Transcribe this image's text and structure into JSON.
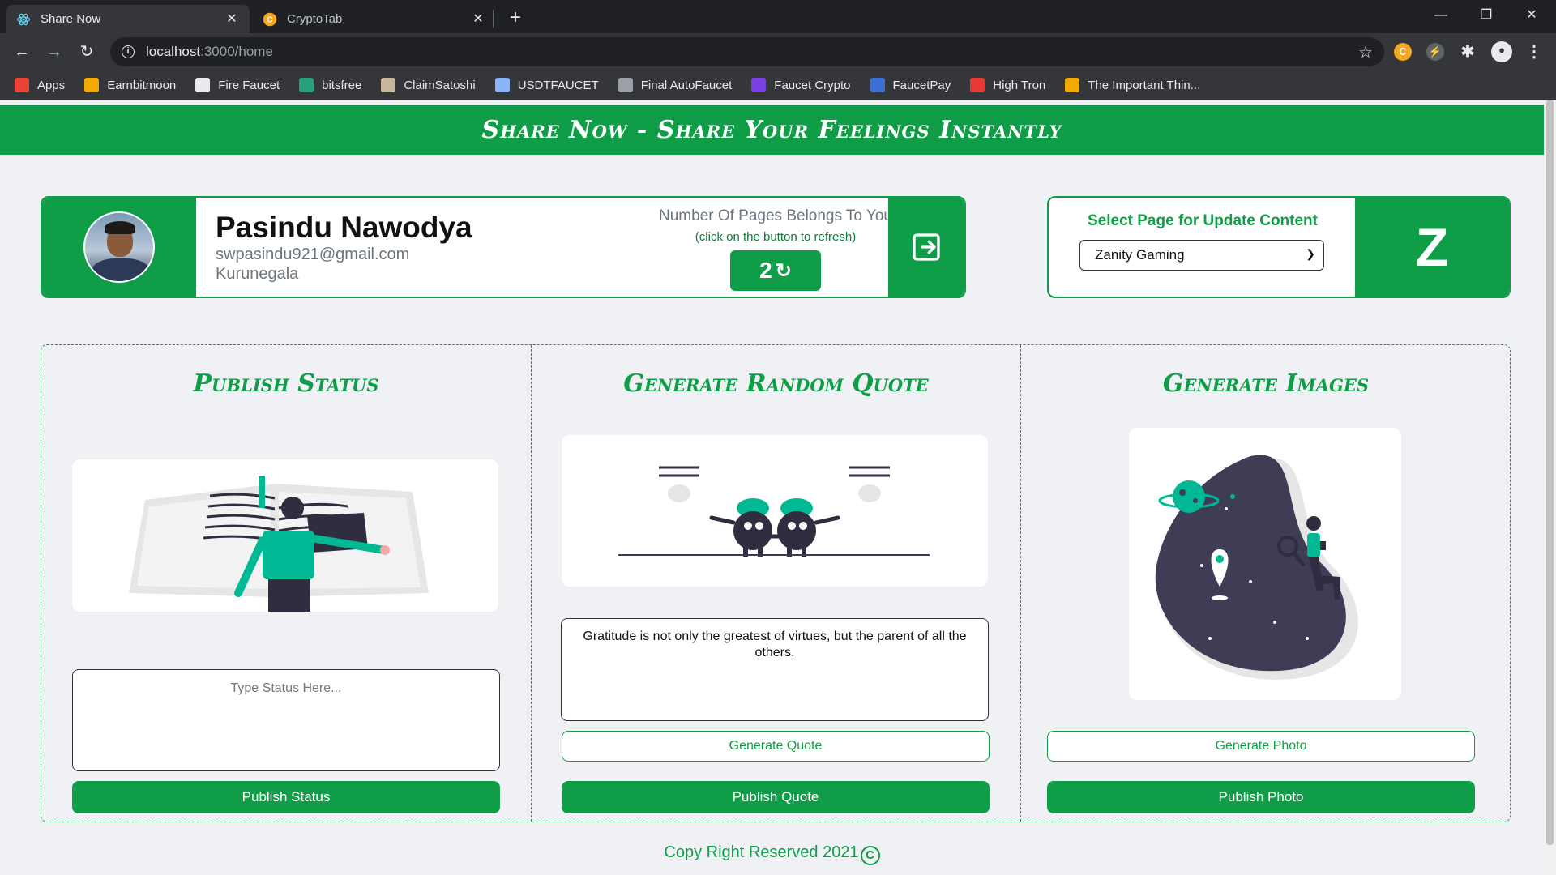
{
  "browser": {
    "tabs": [
      {
        "title": "Share Now",
        "active": true,
        "icon": "react-icon"
      },
      {
        "title": "CryptoTab",
        "active": false,
        "icon": "cryptotab-icon"
      }
    ],
    "url_host": "localhost",
    "url_path": ":3000/home",
    "bookmarks": [
      {
        "label": "Apps",
        "icon": "apps-grid-icon",
        "color": "#ea4335"
      },
      {
        "label": "Earnbitmoon",
        "icon": "bitcoin-icon",
        "color": "#f2a900"
      },
      {
        "label": "Fire Faucet",
        "icon": "firefaucet-icon",
        "color": "#e8eaed"
      },
      {
        "label": "bitsfree",
        "icon": "diamond-icon",
        "color": "#26a17b"
      },
      {
        "label": "ClaimSatoshi",
        "icon": "satoshi-icon",
        "color": "#c9b79c"
      },
      {
        "label": "USDTFAUCET",
        "icon": "usdt-icon",
        "color": "#8ab4f8"
      },
      {
        "label": "Final AutoFaucet",
        "icon": "gear-icon",
        "color": "#9aa0a6"
      },
      {
        "label": "Faucet Crypto",
        "icon": "faucetcrypto-icon",
        "color": "#7b3fe4"
      },
      {
        "label": "FaucetPay",
        "icon": "faucetpay-icon",
        "color": "#3b6fd4"
      },
      {
        "label": "High Tron",
        "icon": "tron-icon",
        "color": "#e53935"
      },
      {
        "label": "The Important Thin...",
        "icon": "bitcoin-small-icon",
        "color": "#f2a900"
      }
    ]
  },
  "app": {
    "header_title": "Share Now - Share Your Feelings Instantly",
    "profile": {
      "name": "Pasindu Nawodya",
      "email": "swpasindu921@gmail.com",
      "city": "Kurunegala",
      "pages_title": "Number Of Pages Belongs To You",
      "pages_hint": "(click on the button to refresh)",
      "pages_count": "2"
    },
    "page_select": {
      "label": "Select Page for Update Content",
      "selected": "Zanity Gaming",
      "initial": "Z"
    },
    "sections": {
      "status": {
        "title": "Publish Status",
        "placeholder": "Type Status Here...",
        "publish_label": "Publish Status"
      },
      "quote": {
        "title": "Generate Random Quote",
        "quote_text": "Gratitude is not only the greatest of virtues, but the parent of all the others.",
        "generate_label": "Generate Quote",
        "publish_label": "Publish Quote"
      },
      "images": {
        "title": "Generate Images",
        "generate_label": "Generate Photo",
        "publish_label": "Publish Photo"
      }
    },
    "footer": "Copy Right Reserved 2021",
    "colors": {
      "brand_green": "#0f9d47",
      "accent_teal": "#00b894",
      "dark_navy": "#2f2e41"
    }
  }
}
